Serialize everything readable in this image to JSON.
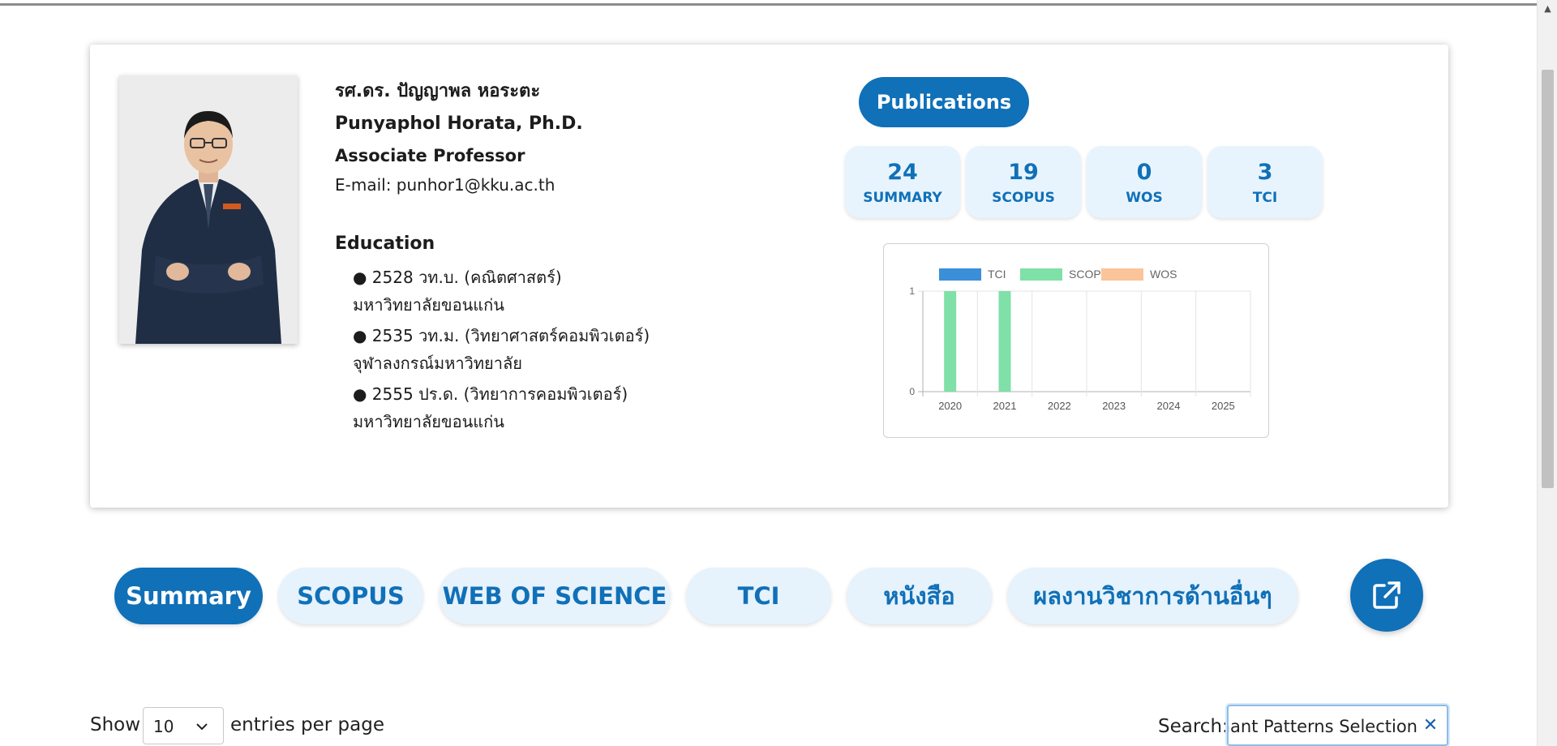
{
  "profile": {
    "name_th": "รศ.ดร. ปัญญาพล หอระตะ",
    "name_en": "Punyaphol Horata, Ph.D.",
    "position": "Associate Professor",
    "email": "E-mail: punhor1@kku.ac.th",
    "education_title": "Education",
    "education": [
      {
        "degree": "● 2528 วท.บ. (คณิตศาสตร์)",
        "university": "มหาวิทยาลัยขอนแก่น"
      },
      {
        "degree": "● 2535 วท.ม. (วิทยาศาสตร์คอมพิวเตอร์)",
        "university": "จุฬาลงกรณ์มหาวิทยาลัย"
      },
      {
        "degree": "● 2555 ปร.ด. (วิทยาการคอมพิวเตอร์)",
        "university": "มหาวิทยาลัยขอนแก่น"
      }
    ]
  },
  "publications_button": "Publications",
  "stats": [
    {
      "value": "24",
      "label": "SUMMARY"
    },
    {
      "value": "19",
      "label": "SCOPUS"
    },
    {
      "value": "0",
      "label": "WOS"
    },
    {
      "value": "3",
      "label": "TCI"
    }
  ],
  "chart_data": {
    "type": "bar",
    "categories": [
      "2020",
      "2021",
      "2022",
      "2023",
      "2024",
      "2025"
    ],
    "series": [
      {
        "name": "TCI",
        "values": [
          0,
          0,
          0,
          0,
          0,
          0
        ],
        "color": "#3a8fd8"
      },
      {
        "name": "SCOPUS",
        "values": [
          1,
          1,
          0,
          0,
          0,
          0
        ],
        "color": "#7fe0a8"
      },
      {
        "name": "WOS",
        "values": [
          0,
          0,
          0,
          0,
          0,
          0
        ],
        "color": "#fbc49a"
      }
    ],
    "ylim": [
      0,
      1
    ],
    "yticks": [
      "0",
      "1"
    ],
    "legend": "top",
    "grid": true
  },
  "tabs": [
    {
      "label": "Summary",
      "active": true
    },
    {
      "label": "SCOPUS",
      "active": false
    },
    {
      "label": "WEB OF SCIENCE",
      "active": false
    },
    {
      "label": "TCI",
      "active": false
    },
    {
      "label": "หนังสือ",
      "active": false
    },
    {
      "label": "ผลงานวิชาการด้านอื่นๆ",
      "active": false
    }
  ],
  "table_controls": {
    "show_label": "Show",
    "entries_value": "10",
    "per_page_label": "entries per page",
    "search_label": "Search:",
    "search_value": "minant Patterns Selection"
  },
  "colors": {
    "accent": "#1070b8",
    "tab_bg": "#e6f2fc"
  }
}
